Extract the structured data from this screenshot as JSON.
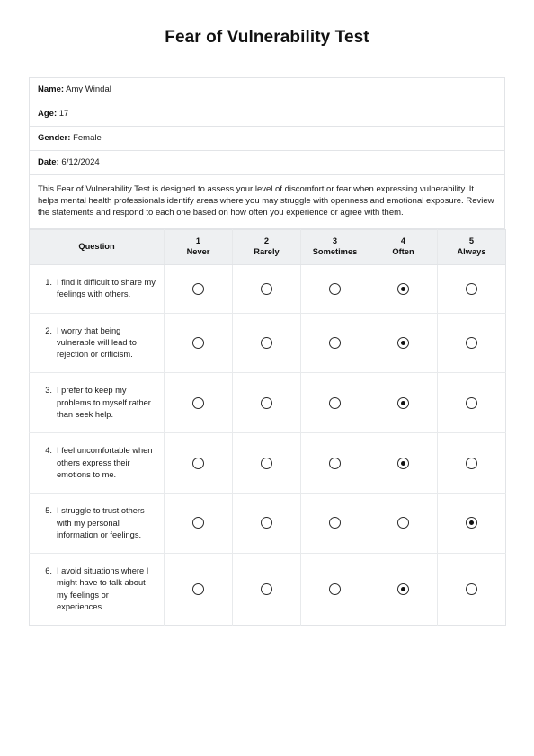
{
  "document": {
    "title": "Fear of Vulnerability Test"
  },
  "info": {
    "rows": [
      {
        "label": "Name:",
        "value": "Amy Windal"
      },
      {
        "label": "Age:",
        "value": "17"
      },
      {
        "label": "Gender:",
        "value": "Female"
      },
      {
        "label": "Date:",
        "value": "6/12/2024"
      }
    ],
    "description": "This Fear of Vulnerability Test is designed to assess your level of discomfort or fear when expressing vulnerability. It helps mental health professionals identify areas where you may struggle with openness and emotional exposure. Review the statements and respond to each one based on how often you experience or agree with them."
  },
  "questionnaire": {
    "headers": {
      "question": "Question",
      "scale": [
        {
          "num": "1",
          "word": "Never"
        },
        {
          "num": "2",
          "word": "Rarely"
        },
        {
          "num": "3",
          "word": "Sometimes"
        },
        {
          "num": "4",
          "word": "Often"
        },
        {
          "num": "5",
          "word": "Always"
        }
      ]
    },
    "items": [
      {
        "num": "1.",
        "text": "I find it difficult to share my feelings with others.",
        "selected": 4
      },
      {
        "num": "2.",
        "text": "I worry that being vulnerable will lead to rejection or criticism.",
        "selected": 4
      },
      {
        "num": "3.",
        "text": "I prefer to keep my problems to myself rather than seek help.",
        "selected": 4
      },
      {
        "num": "4.",
        "text": "I feel uncomfortable when others express their emotions to me.",
        "selected": 4
      },
      {
        "num": "5.",
        "text": "I struggle to trust others with my personal information or feelings.",
        "selected": 5
      },
      {
        "num": "6.",
        "text": "I avoid situations where I might have to talk about my feelings or experiences.",
        "selected": 4
      }
    ]
  },
  "colors": {
    "header_bg": "#eef0f2",
    "border": "#e2e4e7",
    "text": "#1a1a1a"
  }
}
